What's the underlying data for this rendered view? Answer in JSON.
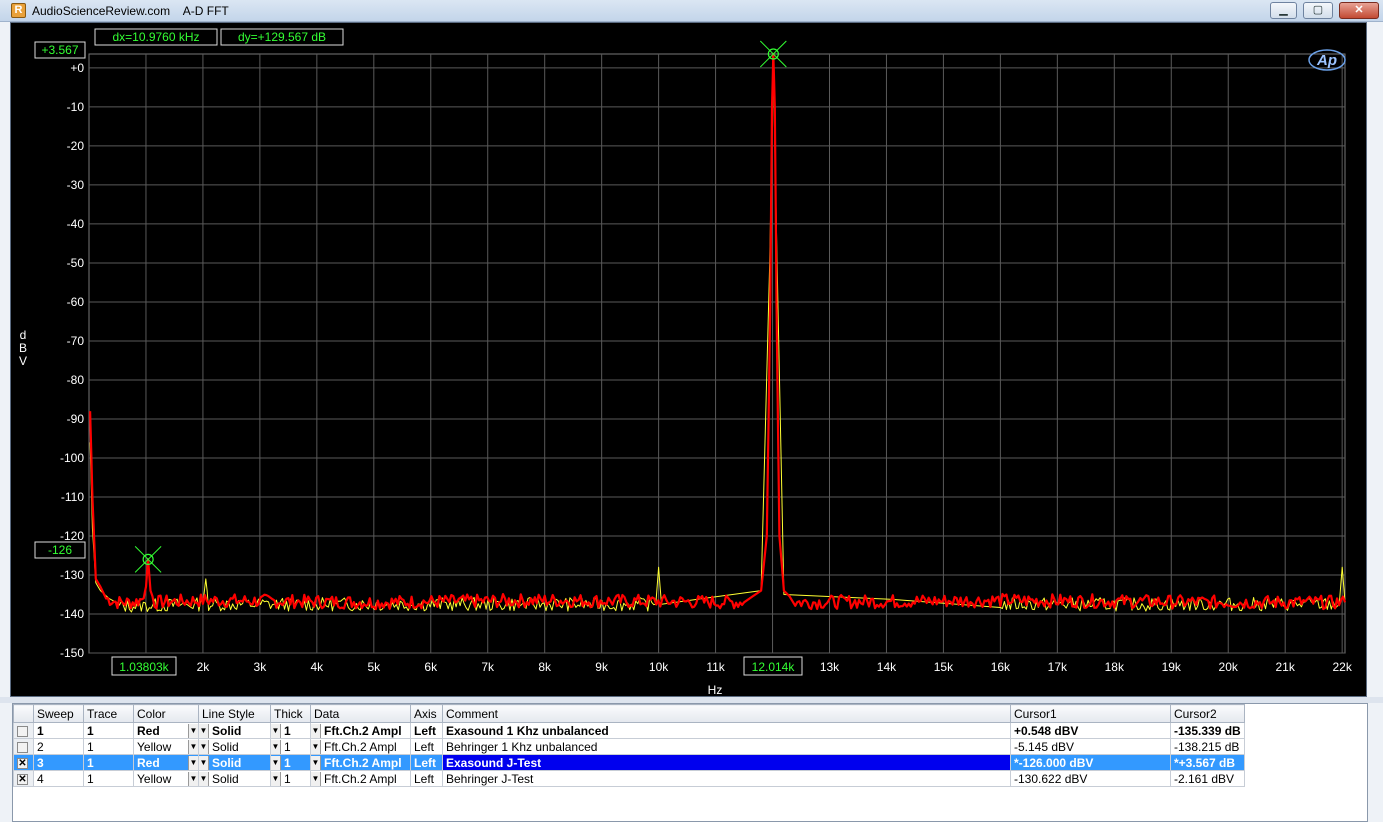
{
  "window": {
    "title": "AudioScienceReview.com    A-D FFT",
    "buttons": {
      "minimize": "▁",
      "maximize": "▢",
      "close": "✕"
    },
    "icon": "ap-app-icon"
  },
  "graph": {
    "logo_text": "Ap",
    "dx_readout": "dx=10.9760 kHz",
    "dy_readout": "dy=+129.567 dB",
    "cursor_y_top": "+3.567",
    "cursor_y_bottom": "-126",
    "cursor_x_left": "1.03803k",
    "cursor_x_right": "12.014k",
    "colors": {
      "background": "#000000",
      "grid": "#5a5a5a",
      "axis_text": "#ffffff",
      "cursor": "#33ff33",
      "red_trace": "#ff0000",
      "yellow_trace": "#ffff33"
    }
  },
  "chart_data": {
    "type": "line",
    "xlabel": "Hz",
    "ylabel": "dBV",
    "xlim": [
      0,
      22050
    ],
    "ylim": [
      -150,
      3.567
    ],
    "x_ticks": [
      "2k",
      "3k",
      "4k",
      "5k",
      "6k",
      "7k",
      "8k",
      "9k",
      "10k",
      "11k",
      "13k",
      "14k",
      "15k",
      "16k",
      "17k",
      "18k",
      "19k",
      "20k",
      "21k",
      "22k"
    ],
    "x_tick_values": [
      2000,
      3000,
      4000,
      5000,
      6000,
      7000,
      8000,
      9000,
      10000,
      11000,
      13000,
      14000,
      15000,
      16000,
      17000,
      18000,
      19000,
      20000,
      21000,
      22000
    ],
    "y_ticks": [
      "+0",
      "-10",
      "-20",
      "-30",
      "-40",
      "-50",
      "-60",
      "-70",
      "-80",
      "-90",
      "-100",
      "-110",
      "-120",
      "-130",
      "-140",
      "-150"
    ],
    "y_tick_values": [
      0,
      -10,
      -20,
      -30,
      -40,
      -50,
      -60,
      -70,
      -80,
      -90,
      -100,
      -110,
      -120,
      -130,
      -140,
      -150
    ],
    "grid": true,
    "cursors": [
      {
        "x": 1038.03,
        "y": -126
      },
      {
        "x": 12014,
        "y": 3.567
      }
    ],
    "series": [
      {
        "color": "#ff0000",
        "width": 2.2,
        "noise_floor": -137,
        "points": [
          [
            20,
            -88
          ],
          [
            60,
            -110
          ],
          [
            120,
            -131
          ],
          [
            200,
            -133
          ],
          [
            300,
            -136
          ],
          [
            500,
            -137
          ],
          [
            800,
            -137
          ],
          [
            960,
            -136
          ],
          [
            1000,
            -133
          ],
          [
            1038,
            -126
          ],
          [
            1080,
            -134
          ],
          [
            1150,
            -137
          ],
          [
            2000,
            -136.5
          ],
          [
            5000,
            -137
          ],
          [
            8000,
            -136.5
          ],
          [
            11500,
            -137
          ],
          [
            11800,
            -134
          ],
          [
            11900,
            -120
          ],
          [
            11960,
            -60
          ],
          [
            11990,
            -10
          ],
          [
            12014,
            3.567
          ],
          [
            12040,
            -10
          ],
          [
            12070,
            -60
          ],
          [
            12120,
            -120
          ],
          [
            12200,
            -134
          ],
          [
            12400,
            -137
          ],
          [
            16000,
            -136.5
          ],
          [
            20000,
            -137
          ],
          [
            22050,
            -137
          ]
        ]
      },
      {
        "color": "#ffff33",
        "width": 1.0,
        "noise_floor": -137.5,
        "points": [
          [
            20,
            -96
          ],
          [
            60,
            -118
          ],
          [
            120,
            -132
          ],
          [
            200,
            -134
          ],
          [
            500,
            -138
          ],
          [
            2000,
            -137.5
          ],
          [
            2050,
            -131
          ],
          [
            2100,
            -137.5
          ],
          [
            9950,
            -137.5
          ],
          [
            10000,
            -128
          ],
          [
            10050,
            -137.5
          ],
          [
            11800,
            -134
          ],
          [
            11950,
            -50
          ],
          [
            12014,
            0.548
          ],
          [
            12080,
            -50
          ],
          [
            12200,
            -135
          ],
          [
            16000,
            -137.5
          ],
          [
            21950,
            -137.5
          ],
          [
            22000,
            -128
          ],
          [
            22050,
            -137
          ]
        ]
      }
    ]
  },
  "table": {
    "headers": [
      "Sweep",
      "Trace",
      "Color",
      "Line Style",
      "Thick",
      "Data",
      "Axis",
      "Comment",
      "Cursor1",
      "Cursor2"
    ],
    "rows": [
      {
        "checked": "",
        "sweep": "1",
        "trace": "1",
        "color": "Red",
        "style": "Solid",
        "thick": "1",
        "data": "Fft.Ch.2 Ampl",
        "axis": "Left",
        "comment": "Exasound 1 Khz unbalanced",
        "cursor1": "+0.548  dBV",
        "cursor2": "-135.339 dB"
      },
      {
        "checked": "",
        "sweep": "2",
        "trace": "1",
        "color": "Yellow",
        "style": "Solid",
        "thick": "1",
        "data": "Fft.Ch.2 Ampl",
        "axis": "Left",
        "comment": "Behringer 1 Khz unbalanced",
        "cursor1": "-5.145  dBV",
        "cursor2": "-138.215 dB"
      },
      {
        "checked": "✕",
        "sweep": "3",
        "trace": "1",
        "color": "Red",
        "style": "Solid",
        "thick": "1",
        "data": "Fft.Ch.2 Ampl",
        "axis": "Left",
        "comment": "Exasound J-Test",
        "cursor1": "*-126.000 dBV",
        "cursor2": "*+3.567  dB"
      },
      {
        "checked": "✕",
        "sweep": "4",
        "trace": "1",
        "color": "Yellow",
        "style": "Solid",
        "thick": "1",
        "data": "Fft.Ch.2 Ampl",
        "axis": "Left",
        "comment": "Behringer J-Test",
        "cursor1": "-130.622 dBV",
        "cursor2": "-2.161  dBV"
      }
    ]
  }
}
